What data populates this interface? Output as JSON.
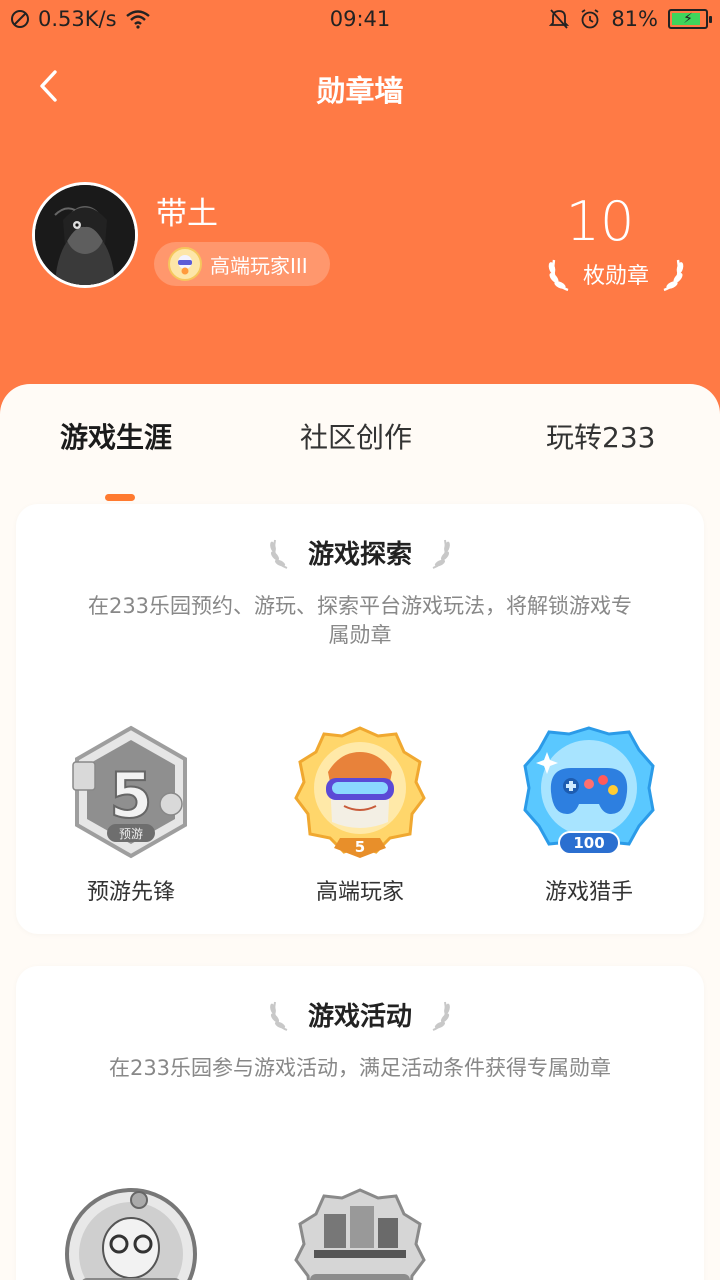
{
  "status_bar": {
    "network_speed": "0.53K/s",
    "time": "09:41",
    "battery_percent": "81%"
  },
  "nav": {
    "title": "勋章墙"
  },
  "profile": {
    "username": "带土",
    "rank_label": "高端玩家III",
    "medal_count": "10",
    "medal_label": "枚勋章"
  },
  "tabs": [
    {
      "label": "游戏生涯",
      "active": true
    },
    {
      "label": "社区创作",
      "active": false
    },
    {
      "label": "玩转233",
      "active": false
    }
  ],
  "sections": [
    {
      "title": "游戏探索",
      "description": "在233乐园预约、游玩、探索平台游戏玩法，将解锁游戏专属勋章",
      "badges": [
        {
          "name": "预游先锋",
          "level_text": "5",
          "tag": "预游",
          "unlocked": false
        },
        {
          "name": "高端玩家",
          "level_text": "5",
          "unlocked": true
        },
        {
          "name": "游戏猎手",
          "level_text": "100",
          "unlocked": true
        }
      ]
    },
    {
      "title": "游戏活动",
      "description": "在233乐园参与游戏活动，满足活动条件获得专属勋章",
      "badges": [
        {
          "name": "",
          "unlocked": false
        },
        {
          "name": "",
          "unlocked": false
        }
      ]
    }
  ],
  "colors": {
    "header": "#ff7a45",
    "accent": "#ff7a30",
    "battery": "#3fd45b"
  }
}
